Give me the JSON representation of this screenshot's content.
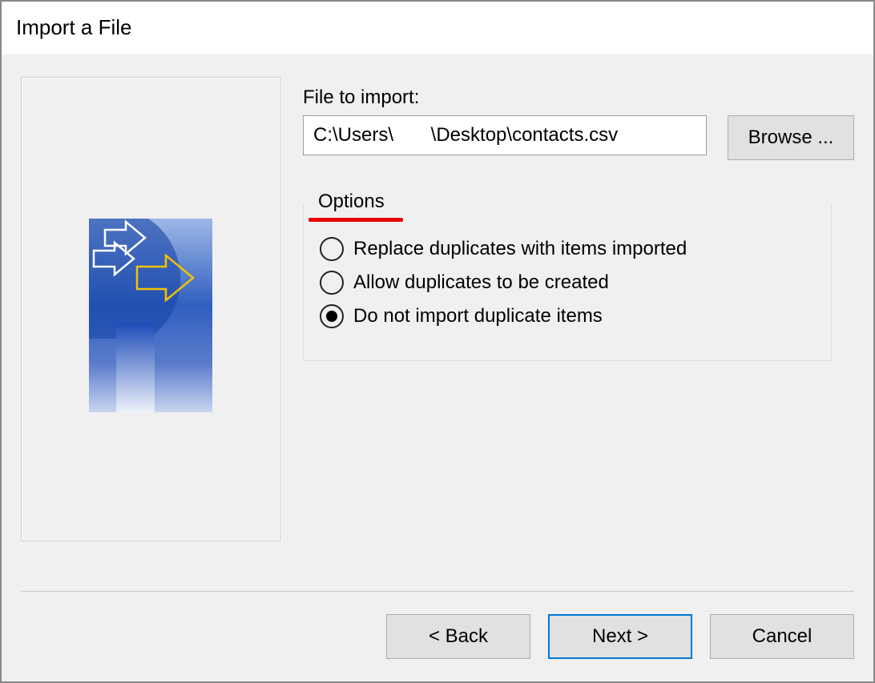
{
  "title": "Import a File",
  "file_label": "File to import:",
  "file_value": "C:\\Users\\       \\Desktop\\contacts.csv",
  "browse_label": "Browse ...",
  "options_legend": "Options",
  "options": [
    {
      "label": "Replace duplicates with items imported",
      "checked": false
    },
    {
      "label": "Allow duplicates to be created",
      "checked": false
    },
    {
      "label": "Do not import duplicate items",
      "checked": true
    }
  ],
  "buttons": {
    "back": "< Back",
    "next": "Next >",
    "cancel": "Cancel"
  }
}
